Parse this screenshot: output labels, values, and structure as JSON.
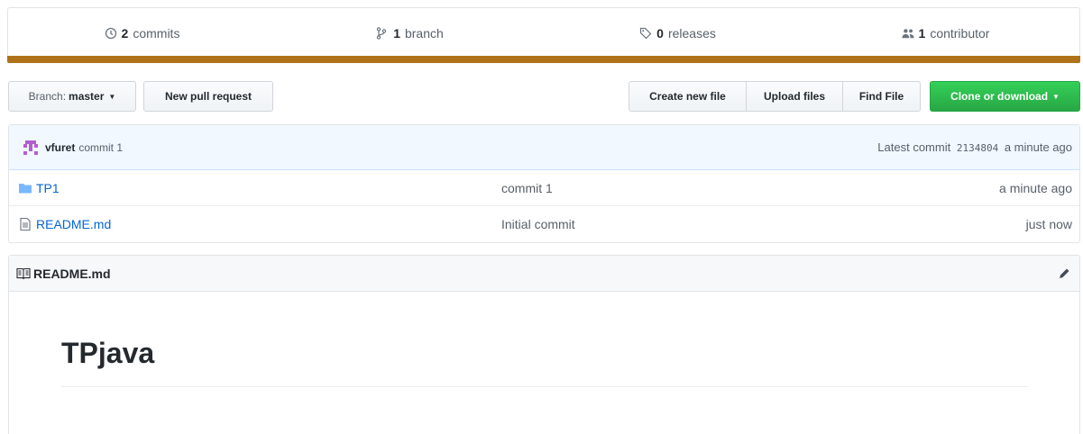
{
  "summary": {
    "commits": {
      "count": "2",
      "label": "commits",
      "icon": "history-icon"
    },
    "branches": {
      "count": "1",
      "label": "branch",
      "icon": "git-branch-icon"
    },
    "releases": {
      "count": "0",
      "label": "releases",
      "icon": "tag-icon"
    },
    "contributors": {
      "count": "1",
      "label": "contributor",
      "icon": "people-icon"
    },
    "language_color": "#b07219"
  },
  "toolbar": {
    "branch_prefix": "Branch:",
    "branch_name": "master",
    "new_pull_request": "New pull request",
    "create_new_file": "Create new file",
    "upload_files": "Upload files",
    "find_file": "Find File",
    "clone_or_download": "Clone or download",
    "clone_color": "#28a745"
  },
  "commit_tease": {
    "author": "vfuret",
    "message": "commit 1",
    "latest_label": "Latest commit",
    "sha": "2134804",
    "age": "a minute ago"
  },
  "files": [
    {
      "icon": "folder-icon",
      "name": "TP1",
      "message": "commit 1",
      "age": "a minute ago"
    },
    {
      "icon": "file-icon",
      "name": "README.md",
      "message": "Initial commit",
      "age": "just now"
    }
  ],
  "readme": {
    "filename": "README.md",
    "heading": "TPjava"
  }
}
